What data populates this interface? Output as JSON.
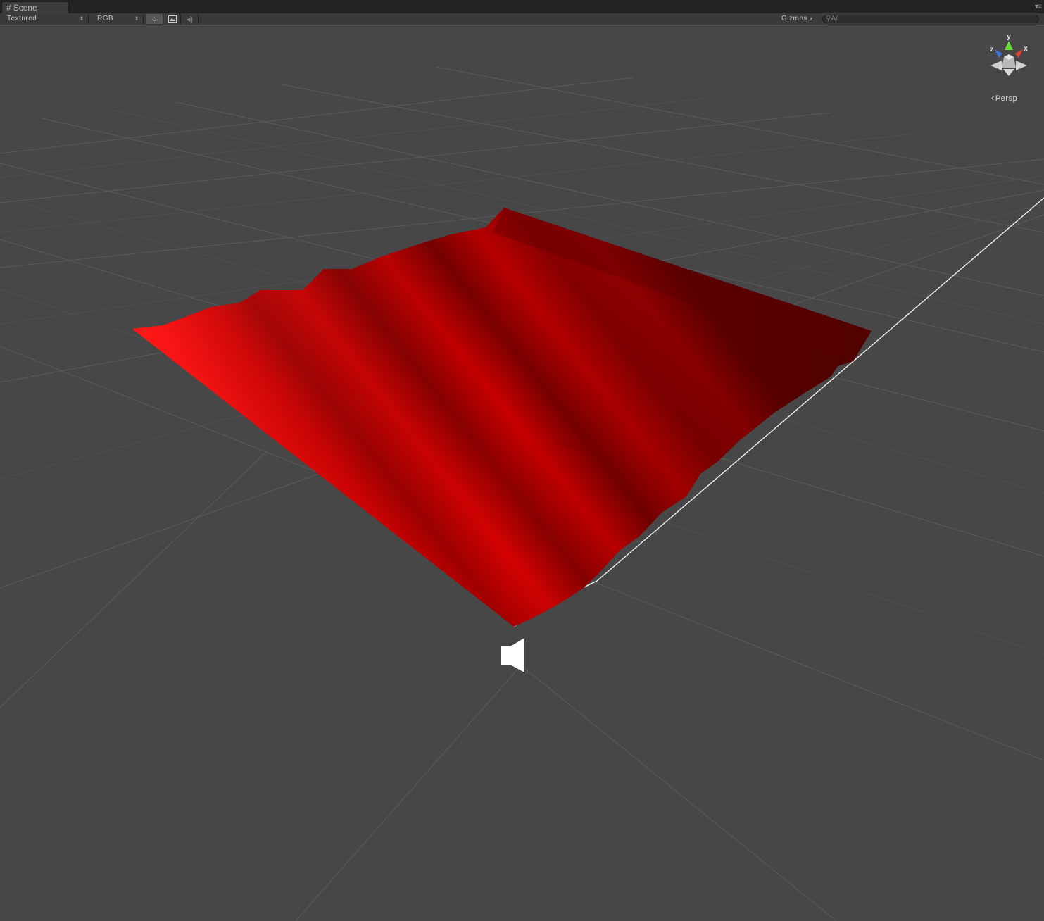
{
  "tab": {
    "title": "Scene",
    "icon": "scene-grid-icon"
  },
  "toolbar": {
    "render_mode": "Textured",
    "channel": "RGB",
    "gizmos_label": "Gizmos",
    "search_placeholder": "All"
  },
  "view_gizmo": {
    "projection_label": "Persp",
    "axes": {
      "y": "y",
      "x": "x",
      "z": "z"
    },
    "colors": {
      "x": "#e0452a",
      "y": "#6cdd3c",
      "z": "#3d73e0"
    }
  },
  "scene": {
    "mesh_color": "#d40000",
    "icons": [
      "sun-light-icon",
      "audio-source-icon"
    ]
  }
}
